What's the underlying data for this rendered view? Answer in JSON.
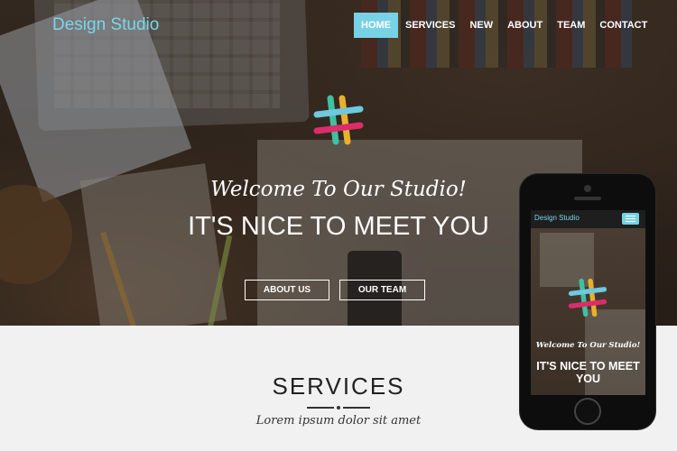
{
  "brand": "Design Studio",
  "nav": {
    "items": [
      {
        "label": "HOME",
        "active": true
      },
      {
        "label": "SERVICES",
        "active": false
      },
      {
        "label": "NEW",
        "active": false
      },
      {
        "label": "ABOUT",
        "active": false
      },
      {
        "label": "TEAM",
        "active": false
      },
      {
        "label": "CONTACT",
        "active": false
      }
    ]
  },
  "hero": {
    "welcome": "Welcome To Our Studio!",
    "headline": "IT'S NICE TO MEET YOU",
    "buttons": {
      "about": "ABOUT US",
      "team": "OUR TEAM"
    }
  },
  "services": {
    "title": "SERVICES",
    "subtitle": "Lorem ipsum dolor sit amet"
  },
  "phone": {
    "brand": "Design Studio",
    "welcome": "Welcome To Our Studio!",
    "headline": "IT'S NICE TO MEET YOU"
  },
  "colors": {
    "accent": "#78d2e6",
    "brand_text": "#78d6ec",
    "services_bg": "#f1f1f1"
  },
  "icons": {
    "logo": "slack-hash-logo-icon",
    "menu": "hamburger-menu-icon"
  }
}
